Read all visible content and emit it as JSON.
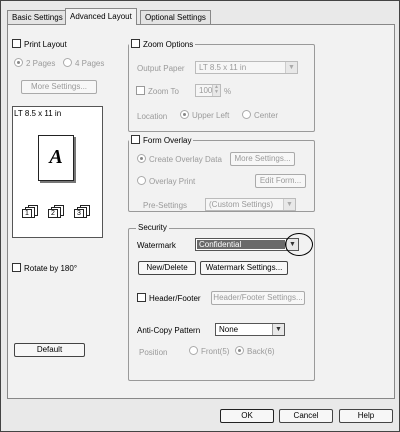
{
  "tabs": [
    {
      "label": "Basic Settings"
    },
    {
      "label": "Advanced Layout"
    },
    {
      "label": "Optional Settings"
    }
  ],
  "print_layout": {
    "label": "Print Layout",
    "radio_2pages": "2 Pages",
    "radio_4pages": "4 Pages",
    "more_settings": "More Settings..."
  },
  "preview": {
    "paper": "LT 8.5 x 11 in",
    "sample_letter": "A",
    "copy_numbers": [
      "1",
      "2",
      "3"
    ]
  },
  "rotate": {
    "label": "Rotate by 180°"
  },
  "default_button": "Default",
  "zoom": {
    "label": "Zoom Options",
    "output_paper_label": "Output Paper",
    "output_paper_value": "LT 8.5 x 11 in",
    "zoom_to_label": "Zoom To",
    "zoom_value": "100",
    "percent": "%",
    "location_label": "Location",
    "upper_left": "Upper Left",
    "center": "Center"
  },
  "form_overlay": {
    "label": "Form Overlay",
    "create_label": "Create Overlay Data",
    "more_settings": "More Settings...",
    "overlay_print": "Overlay Print",
    "edit_form": "Edit Form...",
    "presettings_label": "Pre-Settings",
    "presettings_value": "(Custom Settings)"
  },
  "security": {
    "label": "Security",
    "watermark_label": "Watermark",
    "watermark_value": "Confidential",
    "new_delete": "New/Delete",
    "watermark_settings": "Watermark Settings...",
    "header_footer_label": "Header/Footer",
    "header_footer_settings": "Header/Footer Settings...",
    "anticopy_label": "Anti-Copy Pattern",
    "anticopy_value": "None",
    "position_label": "Position",
    "front": "Front(5)",
    "back": "Back(6)"
  },
  "dialog_buttons": {
    "ok": "OK",
    "cancel": "Cancel",
    "help": "Help"
  }
}
